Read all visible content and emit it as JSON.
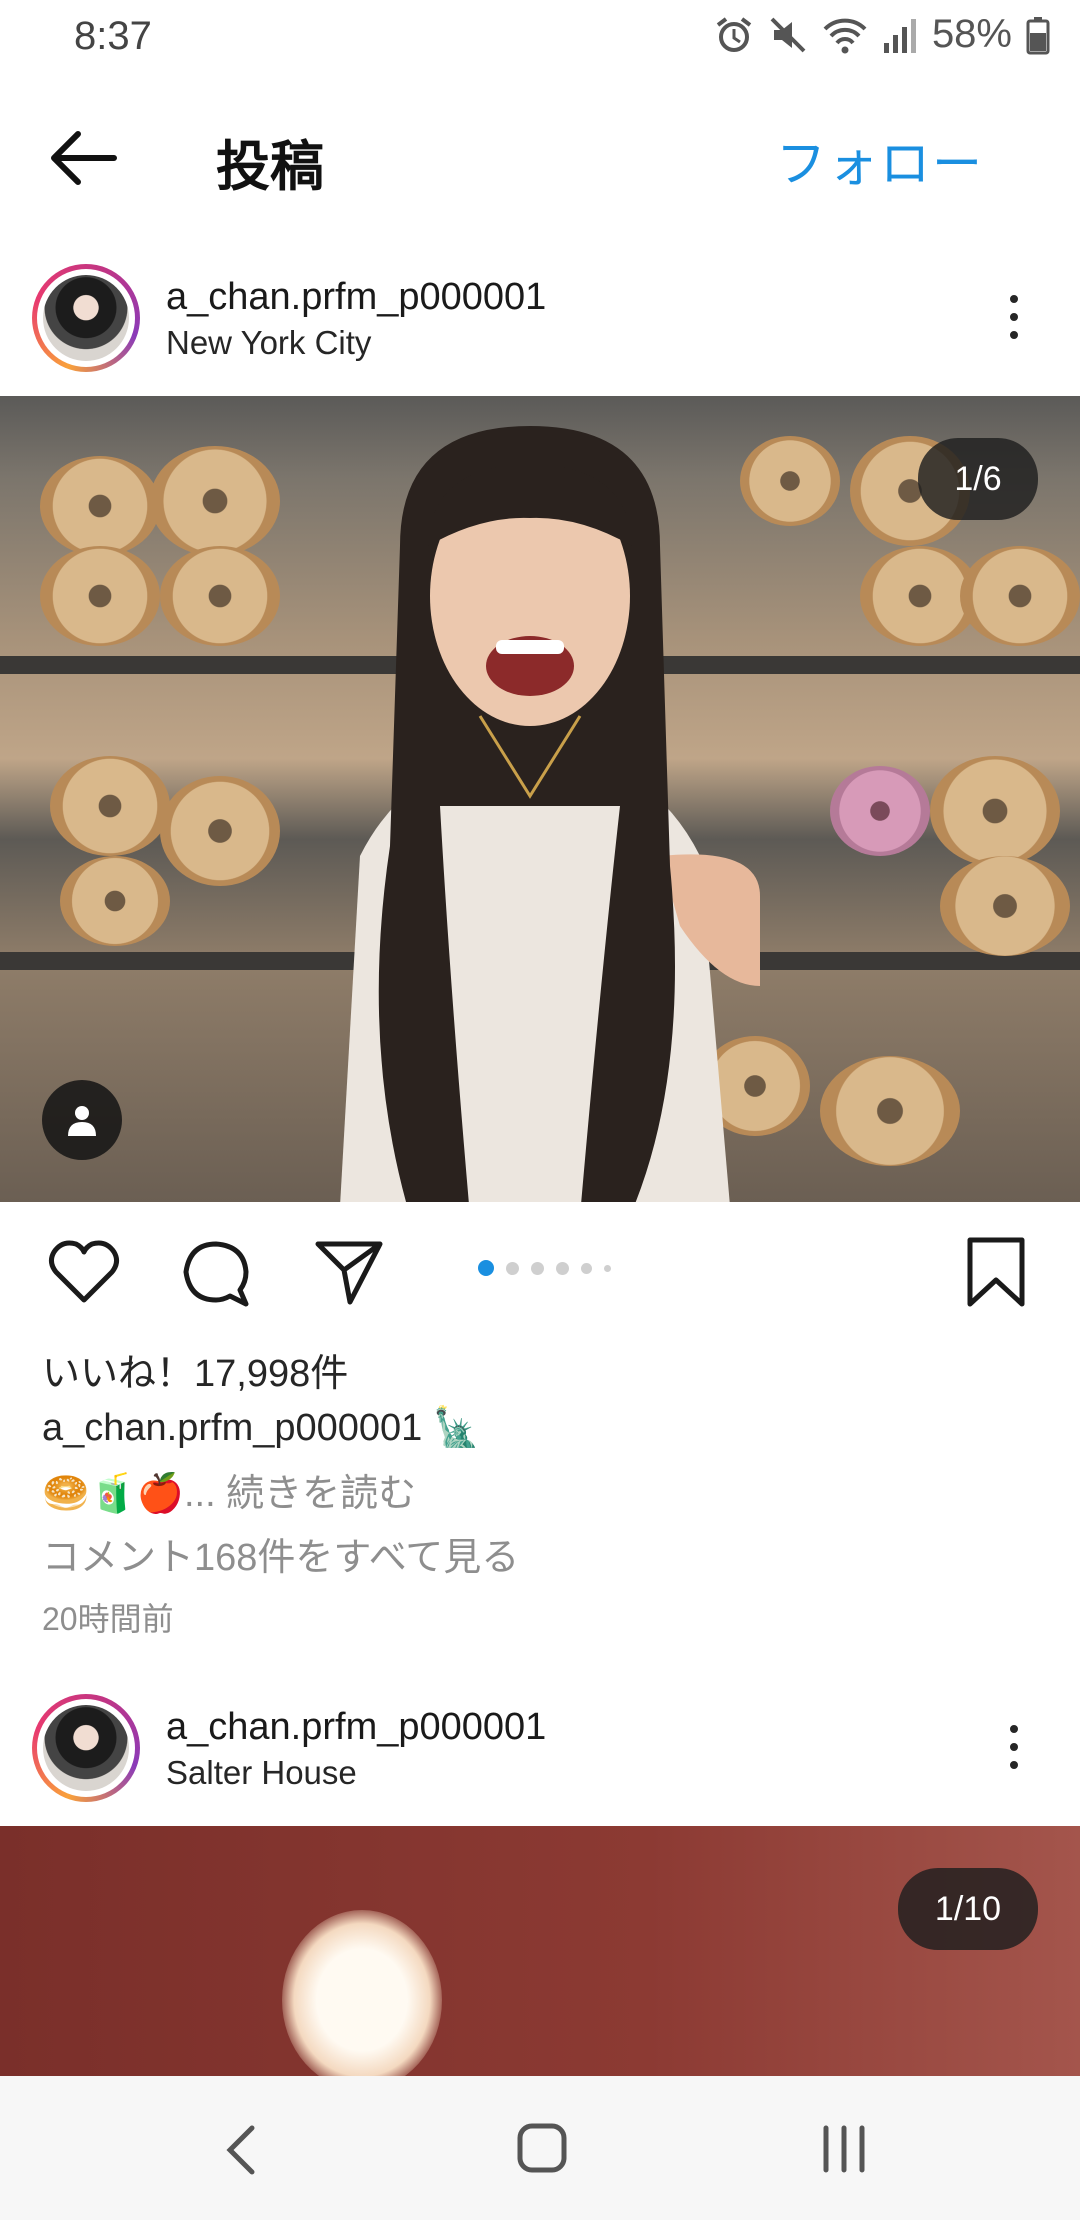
{
  "status_bar": {
    "time": "8:37",
    "battery_percent": "58%",
    "icons": [
      "alarm-icon",
      "mute-icon",
      "wifi-icon",
      "signal-icon",
      "battery-icon"
    ]
  },
  "header": {
    "back_icon": "arrow-left-icon",
    "title": "投稿",
    "follow_label": "フォロー"
  },
  "post1": {
    "username": "a_chan.prfm_p000001",
    "location": "New York City",
    "media_counter": "1/6",
    "carousel": {
      "count": 6,
      "active_index": 0
    },
    "likes_text": "いいね！17,998件",
    "caption_username": "a_chan.prfm_p000001",
    "caption_emoji": "🗽",
    "caption_line2_emoji": "🥯🧃🍎",
    "caption_more": "... 続きを読む",
    "comments_link": "コメント168件をすべて見る",
    "time_ago": "20時間前"
  },
  "post2": {
    "username": "a_chan.prfm_p000001",
    "location": "Salter House",
    "media_counter": "1/10"
  },
  "nav_bar": {
    "icons": [
      "nav-back-icon",
      "nav-home-icon",
      "nav-recents-icon"
    ]
  },
  "colors": {
    "accent": "#1a8fe0",
    "text": "#262626",
    "muted": "#8e8e8e"
  }
}
